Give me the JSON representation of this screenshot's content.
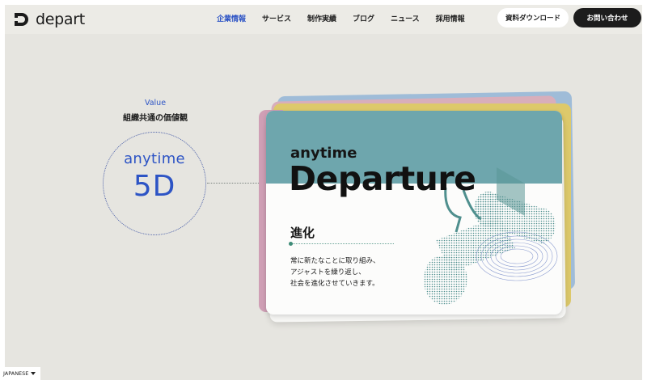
{
  "brand": {
    "name": "depart"
  },
  "nav": {
    "items": [
      {
        "label": "企業情報",
        "active": true
      },
      {
        "label": "サービス",
        "active": false
      },
      {
        "label": "制作実績",
        "active": false
      },
      {
        "label": "ブログ",
        "active": false
      },
      {
        "label": "ニュース",
        "active": false
      },
      {
        "label": "採用情報",
        "active": false
      }
    ]
  },
  "header": {
    "download_label": "資料ダウンロード",
    "contact_label": "お問い合わせ"
  },
  "value": {
    "label": "Value",
    "subtitle": "組織共通の価値観",
    "circle_line1": "anytime",
    "circle_line2": "5D"
  },
  "card": {
    "kicker": "anytime",
    "title": "Departure",
    "heading": "進化",
    "description": [
      "常に新たなことに取り組み、",
      "アジャストを繰り返し、",
      "社会を進化させていきます。"
    ]
  },
  "language": {
    "label": "JAPANESE"
  },
  "colors": {
    "accent": "#2d54c5",
    "background": "#e6e5e0",
    "card_teal": "#6ea6ad",
    "card_blue": "#9fbcd8",
    "card_yellow": "#ddc96b",
    "card_pink": "#d8aebb"
  }
}
